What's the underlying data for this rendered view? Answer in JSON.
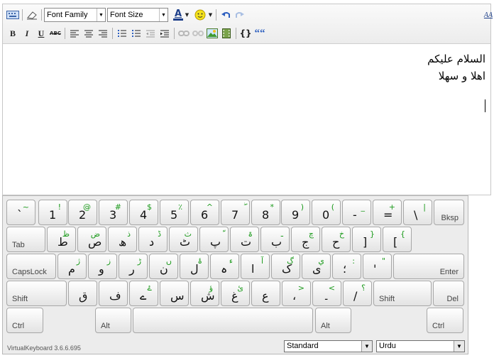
{
  "toolbar": {
    "font_family": "Font Family",
    "font_size": "Font Size",
    "font_color_label": "A",
    "bold": "B",
    "italic": "I",
    "underline": "U",
    "strike": "ABC",
    "code": "{}",
    "quote": "““",
    "scale_label": "AA"
  },
  "content": {
    "lines": [
      "السلام عليكم",
      "اهلا و سهلا"
    ]
  },
  "keyboard": {
    "rows": [
      [
        {
          "main": "`",
          "shift": "~"
        },
        {
          "main": "1",
          "shift": "!"
        },
        {
          "main": "2",
          "shift": "@"
        },
        {
          "main": "3",
          "shift": "#"
        },
        {
          "main": "4",
          "shift": "$"
        },
        {
          "main": "5",
          "shift": "٪"
        },
        {
          "main": "6",
          "shift": "^"
        },
        {
          "main": "7",
          "shift": "ۖ"
        },
        {
          "main": "8",
          "shift": "*"
        },
        {
          "main": "9",
          "shift": ")"
        },
        {
          "main": "0",
          "shift": "("
        },
        {
          "main": "-",
          "shift": "_"
        },
        {
          "main": "=",
          "shift": "+"
        },
        {
          "main": "\\",
          "shift": "|"
        },
        {
          "label": "Bksp"
        }
      ],
      [
        {
          "label": "Tab"
        },
        {
          "main": "ط",
          "shift": "ظ"
        },
        {
          "main": "ص",
          "shift": "ض"
        },
        {
          "main": "ھ",
          "shift": "ذ"
        },
        {
          "main": "د",
          "shift": "ڈ"
        },
        {
          "main": "ٹ",
          "shift": "ث"
        },
        {
          "main": "پ",
          "shift": "ّ"
        },
        {
          "main": "ت",
          "shift": "ۃ"
        },
        {
          "main": "ب",
          "shift": "ـ"
        },
        {
          "main": "ج",
          "shift": "چ"
        },
        {
          "main": "ح",
          "shift": "خ"
        },
        {
          "main": "]",
          "shift": "}"
        },
        {
          "main": "[",
          "shift": "{"
        }
      ],
      [
        {
          "label": "CapsLock"
        },
        {
          "main": "م",
          "shift": "ژ"
        },
        {
          "main": "و",
          "shift": "ز"
        },
        {
          "main": "ر",
          "shift": "ڑ"
        },
        {
          "main": "ن",
          "shift": "ں"
        },
        {
          "main": "ل",
          "shift": "ۂ"
        },
        {
          "main": "ہ",
          "shift": "ء"
        },
        {
          "main": "ا",
          "shift": "آ"
        },
        {
          "main": "ک",
          "shift": "گ"
        },
        {
          "main": "ی",
          "shift": "ي"
        },
        {
          "main": "؛",
          "shift": ":"
        },
        {
          "main": "'",
          "shift": "\""
        },
        {
          "label": "Enter"
        }
      ],
      [
        {
          "label": "Shift"
        },
        {
          "main": "ق",
          "shift": ""
        },
        {
          "main": "ف",
          "shift": ""
        },
        {
          "main": "ے",
          "shift": "ۓ"
        },
        {
          "main": "س",
          "shift": ""
        },
        {
          "main": "ش",
          "shift": "ؤ"
        },
        {
          "main": "غ",
          "shift": "ئ"
        },
        {
          "main": "ع",
          "shift": ""
        },
        {
          "main": "،",
          "shift": ">"
        },
        {
          "main": "۔",
          "shift": "<"
        },
        {
          "main": "/",
          "shift": "؟"
        },
        {
          "label": "Shift"
        },
        {
          "label": "Del"
        }
      ],
      [
        {
          "label": "Ctrl"
        },
        {
          "label": "Alt"
        },
        {
          "label": ""
        },
        {
          "label": "Alt"
        },
        {
          "label": "Ctrl"
        }
      ]
    ],
    "version": "VirtualKeyboard 3.6.6.695",
    "layout_select": "Standard",
    "language_select": "Urdu"
  },
  "colors": {
    "shift_char": "#1b9a1b",
    "toolbar_bg": "#ececec",
    "keyboard_bg": "#ececec"
  }
}
